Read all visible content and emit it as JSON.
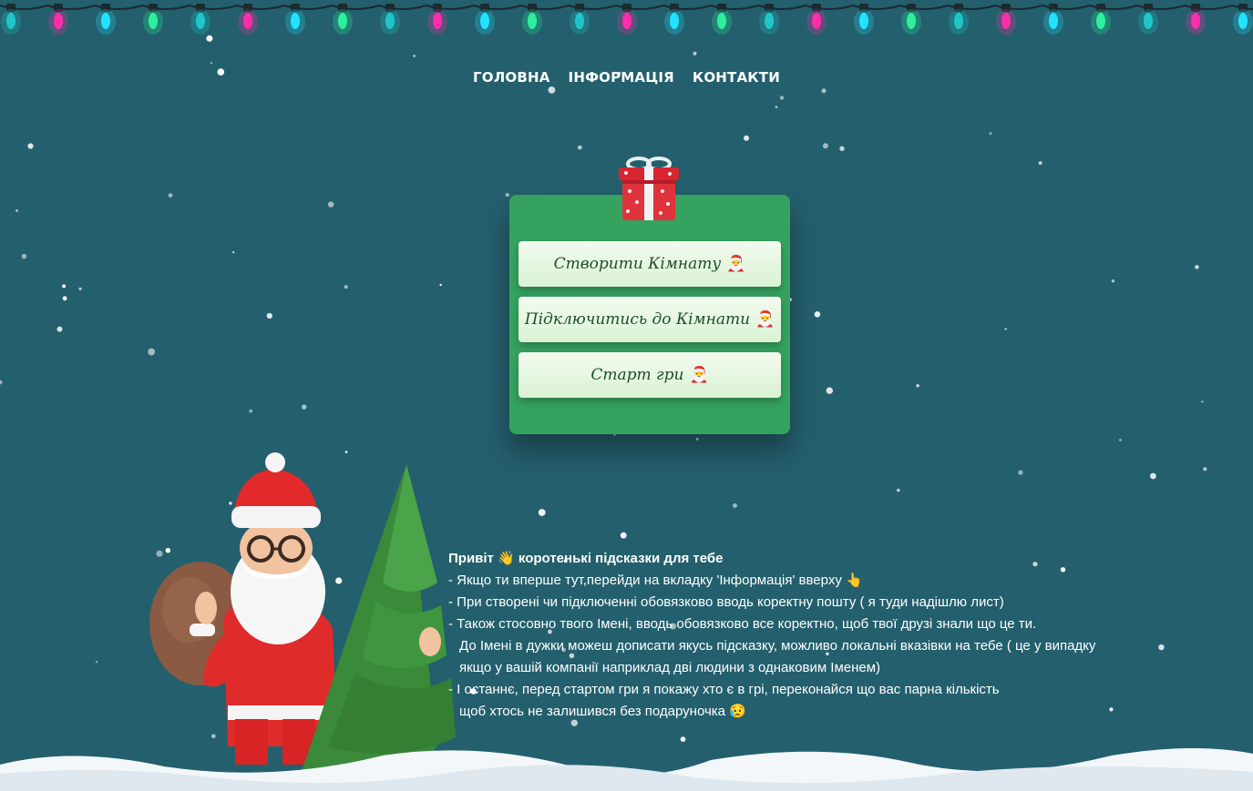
{
  "nav": {
    "home": "ГОЛОВНА",
    "info": "ІНФОРМАЦІЯ",
    "contacts": "КОНТАКТИ"
  },
  "menu": {
    "create_room": "Створити Кімнату",
    "join_room": "Підключитись до Кімнати",
    "start_game": "Старт гри",
    "button_emoji": "🎅"
  },
  "tips": {
    "title": "Привіт 👋 коротенькі підсказки для тебе",
    "line1": "- Якщо ти вперше тут,перейди на вкладку 'Інформація' вверху 👆",
    "line2": "- При створені чи підключенні обовязково вводь коректну пошту ( я туди надішлю лист)",
    "line3": "- Також стосовно твого Імені, вводь обовязково все коректно, щоб твої друзі знали що це ти.",
    "line3b": "До Імені в дужки можеш дописати якусь підсказку, можливо локальні вказівки на тебе ( це у випадку",
    "line3c": "якщо у вашій компанії наприклад дві людини з однаковим Іменем)",
    "line4": "- І останнє, перед стартом гри я покажу хто є в грі, переконайся що вас парна кількість",
    "line4b": "щоб хтось не залишився без подаруночка 😥"
  },
  "colors": {
    "background": "#245f6d",
    "card": "#35a25f",
    "button_text": "#1f4d27",
    "light_pink": "#ff2da8",
    "light_cyan": "#22e3ff",
    "light_green": "#2cf09a",
    "light_teal": "#1fc6c8"
  },
  "icons": {
    "gift": "gift-icon",
    "santa": "santa-illustration",
    "tree": "christmas-tree-illustration",
    "lights": "string-lights-decoration"
  }
}
